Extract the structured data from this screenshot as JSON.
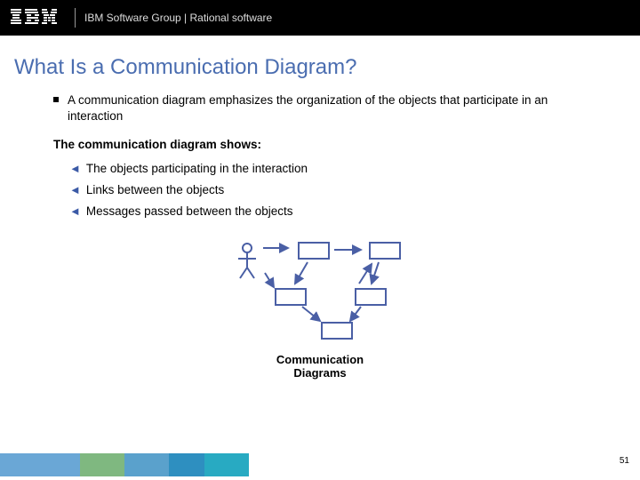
{
  "header": {
    "group_text": "IBM Software Group | Rational software"
  },
  "title": "What Is a Communication Diagram?",
  "main": {
    "bullet": "A communication diagram emphasizes the organization of the objects that participate in an interaction",
    "sub_heading": "The communication diagram shows:",
    "arrows": [
      "The objects participating in the interaction",
      "Links between the objects",
      "Messages passed between the objects"
    ]
  },
  "diagram": {
    "caption_line1": "Communication",
    "caption_line2": "Diagrams"
  },
  "footer": {
    "page": "51"
  }
}
